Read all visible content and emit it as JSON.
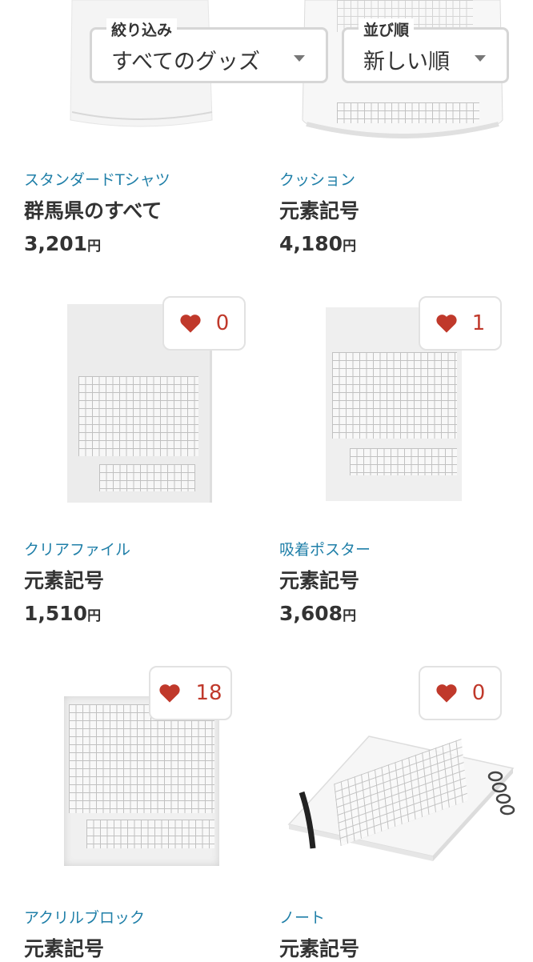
{
  "filters": {
    "narrow": {
      "label": "絞り込み",
      "value": "すべてのグッズ"
    },
    "sort": {
      "label": "並び順",
      "value": "新しい順"
    }
  },
  "currency_suffix": "円",
  "products": [
    {
      "type": "スタンダードTシャツ",
      "title": "群馬県のすべて",
      "price": "3,201",
      "favorites": null
    },
    {
      "type": "クッション",
      "title": "元素記号",
      "price": "4,180",
      "favorites": null
    },
    {
      "type": "クリアファイル",
      "title": "元素記号",
      "price": "1,510",
      "favorites": "0"
    },
    {
      "type": "吸着ポスター",
      "title": "元素記号",
      "price": "3,608",
      "favorites": "1"
    },
    {
      "type": "アクリルブロック",
      "title": "元素記号",
      "price": "",
      "favorites": "18"
    },
    {
      "type": "ノート",
      "title": "元素記号",
      "price": "",
      "favorites": "0"
    }
  ],
  "colors": {
    "accent": "#1f7fa8",
    "heart": "#c0392b",
    "text": "#333333",
    "border": "#d6d6d6"
  },
  "icons": {
    "favorite": "heart-icon",
    "dropdown": "caret-down-icon"
  }
}
